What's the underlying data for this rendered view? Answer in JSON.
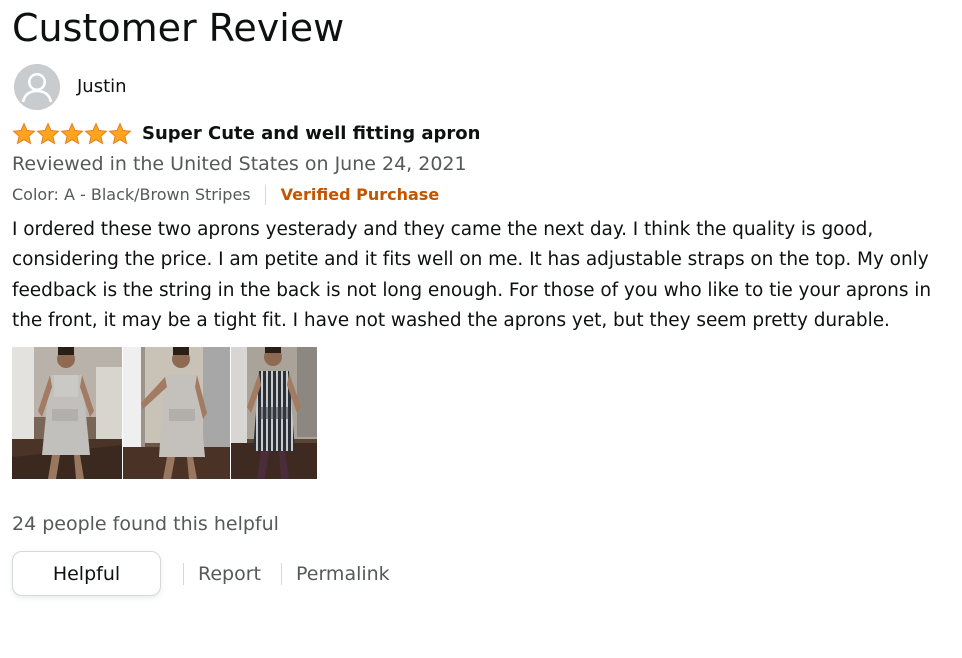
{
  "page": {
    "title": "Customer Review"
  },
  "reviewer": {
    "name": "Justin",
    "avatar_icon": "default-user-avatar-icon"
  },
  "review": {
    "rating": 5,
    "rating_max": 5,
    "star_icon": "star-icon",
    "star_color": "#FFA41C",
    "title": "Super Cute and well fitting apron",
    "date": "Reviewed in the United States on June 24, 2021",
    "variant": "Color: A - Black/Brown Stripes",
    "verified": "Verified Purchase",
    "verified_color": "#C45500",
    "body_lines": [
      "I ordered these two aprons yesterady and they came the next day. I think the quality is good,",
      "considering the price. I am petite and it fits well on me. It has adjustable straps on the top. My only",
      "feedback is the string in the back is not long enough. For those of you who like to tie your aprons in",
      "the front, it may be a tight fit. I have not washed the aprons yet, but they seem pretty durable."
    ],
    "images": [
      {
        "name": "review-image-grey-apron-front"
      },
      {
        "name": "review-image-grey-apron-doorway"
      },
      {
        "name": "review-image-striped-apron"
      }
    ]
  },
  "feedback": {
    "helpful_count": "24 people found this helpful",
    "helpful_label": "Helpful",
    "report_label": "Report",
    "permalink_label": "Permalink"
  }
}
